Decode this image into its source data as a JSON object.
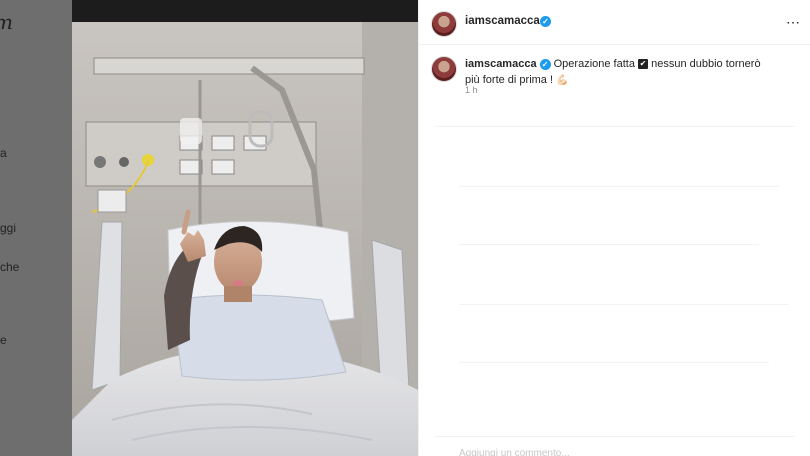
{
  "background": {
    "logo_fragment": "m",
    "nav_fragments": [
      "a",
      "ggi",
      "che",
      "e"
    ]
  },
  "post": {
    "author": {
      "username": "iamscamacca",
      "verified": true
    },
    "caption": {
      "username": "iamscamacca",
      "text_part1": "Operazione fatta",
      "check_emoji": "✔",
      "text_part2": "nessun dubbio tornerò più forte di prima !",
      "emoji": "💪🏻"
    },
    "time": "1 h",
    "comment_placeholder": "Aggiungi un commento..."
  },
  "icons": {
    "verified": "verified-badge-icon",
    "more": "more-options-icon"
  },
  "colors": {
    "verified_blue": "#1d9bf0",
    "text": "#262626",
    "muted": "#8e8e8e"
  }
}
